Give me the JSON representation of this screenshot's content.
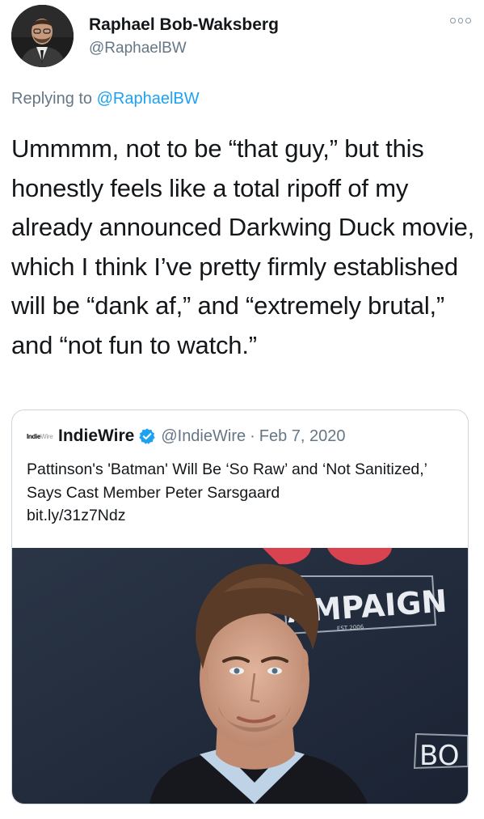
{
  "author": {
    "name": "Raphael Bob-Waksberg",
    "handle": "@RaphaelBW"
  },
  "reply": {
    "prefix": "Replying to",
    "mention": "@RaphaelBW"
  },
  "tweet": {
    "text": "Ummmm, not to be “that guy,” but this honestly feels like a total ripoff of my already announced Darkwing Duck movie, which I think I’ve pretty firmly established will be “dank af,” and “extremely brutal,” and “not fun to watch.”"
  },
  "quoted": {
    "logo_text_1": "Indie",
    "logo_text_2": "Wire",
    "name": "IndieWire",
    "handle": "@IndieWire",
    "separator": "·",
    "date": "Feb 7, 2020",
    "text": "Pattinson's 'Batman' Will Be ‘So Raw’ and ‘Not Sanitized,’ Says Cast Member Peter Sarsgaard",
    "link": "bit.ly/31z7Ndz",
    "image_sign_text": "AMPAIGN",
    "image_sign_small": "EST 2006",
    "image_corner_text": "BO"
  },
  "icons": {
    "more": "more-options-icon",
    "verified": "verified-badge-icon"
  },
  "colors": {
    "link": "#1da1f2",
    "secondary_text": "#657786",
    "verified": "#1da1f2"
  }
}
